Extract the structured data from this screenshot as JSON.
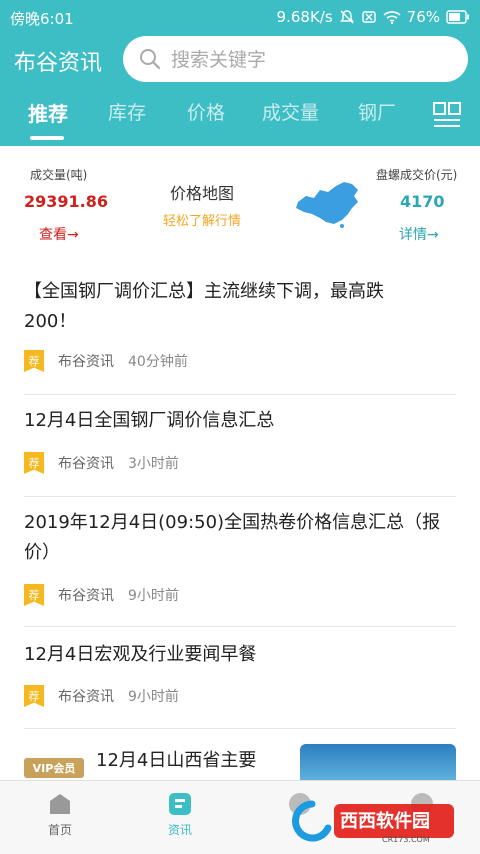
{
  "status_bar": {
    "time": "傍晚6:01",
    "speed": "9.68K/s",
    "battery": "76%"
  },
  "header": {
    "app_title": "布谷资讯",
    "search_placeholder": "搜索关键字"
  },
  "tabs": [
    {
      "label": "推荐",
      "active": true
    },
    {
      "label": "库存",
      "active": false
    },
    {
      "label": "价格",
      "active": false
    },
    {
      "label": "成交量",
      "active": false
    },
    {
      "label": "钢厂",
      "active": false
    }
  ],
  "summary": {
    "volume_label": "成交量(吨)",
    "volume_value": "29391.86",
    "volume_link": "查看→",
    "map_title": "价格地图",
    "map_subtitle": "轻松了解行情",
    "coil_label": "盘螺成交价(元)",
    "coil_value": "4170",
    "coil_link": "详情→"
  },
  "feed": [
    {
      "title": "【全国钢厂调价汇总】主流继续下调，最高跌200！",
      "badge": "荐",
      "source": "布谷资讯",
      "time": "40分钟前"
    },
    {
      "title": "12月4日全国钢厂调价信息汇总",
      "badge": "荐",
      "source": "布谷资讯",
      "time": "3小时前"
    },
    {
      "title": "2019年12月4日(09:50)全国热卷价格信息汇总（报价）",
      "badge": "荐",
      "source": "布谷资讯",
      "time": "9小时前"
    },
    {
      "title": "12月4日宏观及行业要闻早餐",
      "badge": "荐",
      "source": "布谷资讯",
      "time": "9小时前"
    }
  ],
  "vip_item": {
    "badge": "VIP会员",
    "title": "12月4日山西省主要"
  },
  "bottom_nav": [
    {
      "label": "首页",
      "active": false
    },
    {
      "label": "资讯",
      "active": true
    }
  ],
  "colors": {
    "accent": "#3dbdc4",
    "volume_red": "#d0201c",
    "teal_value": "#2aa6b4",
    "badge_yellow": "#f5b820"
  },
  "watermark": {
    "text": "西西软件园",
    "domain": "CR173.COM"
  }
}
